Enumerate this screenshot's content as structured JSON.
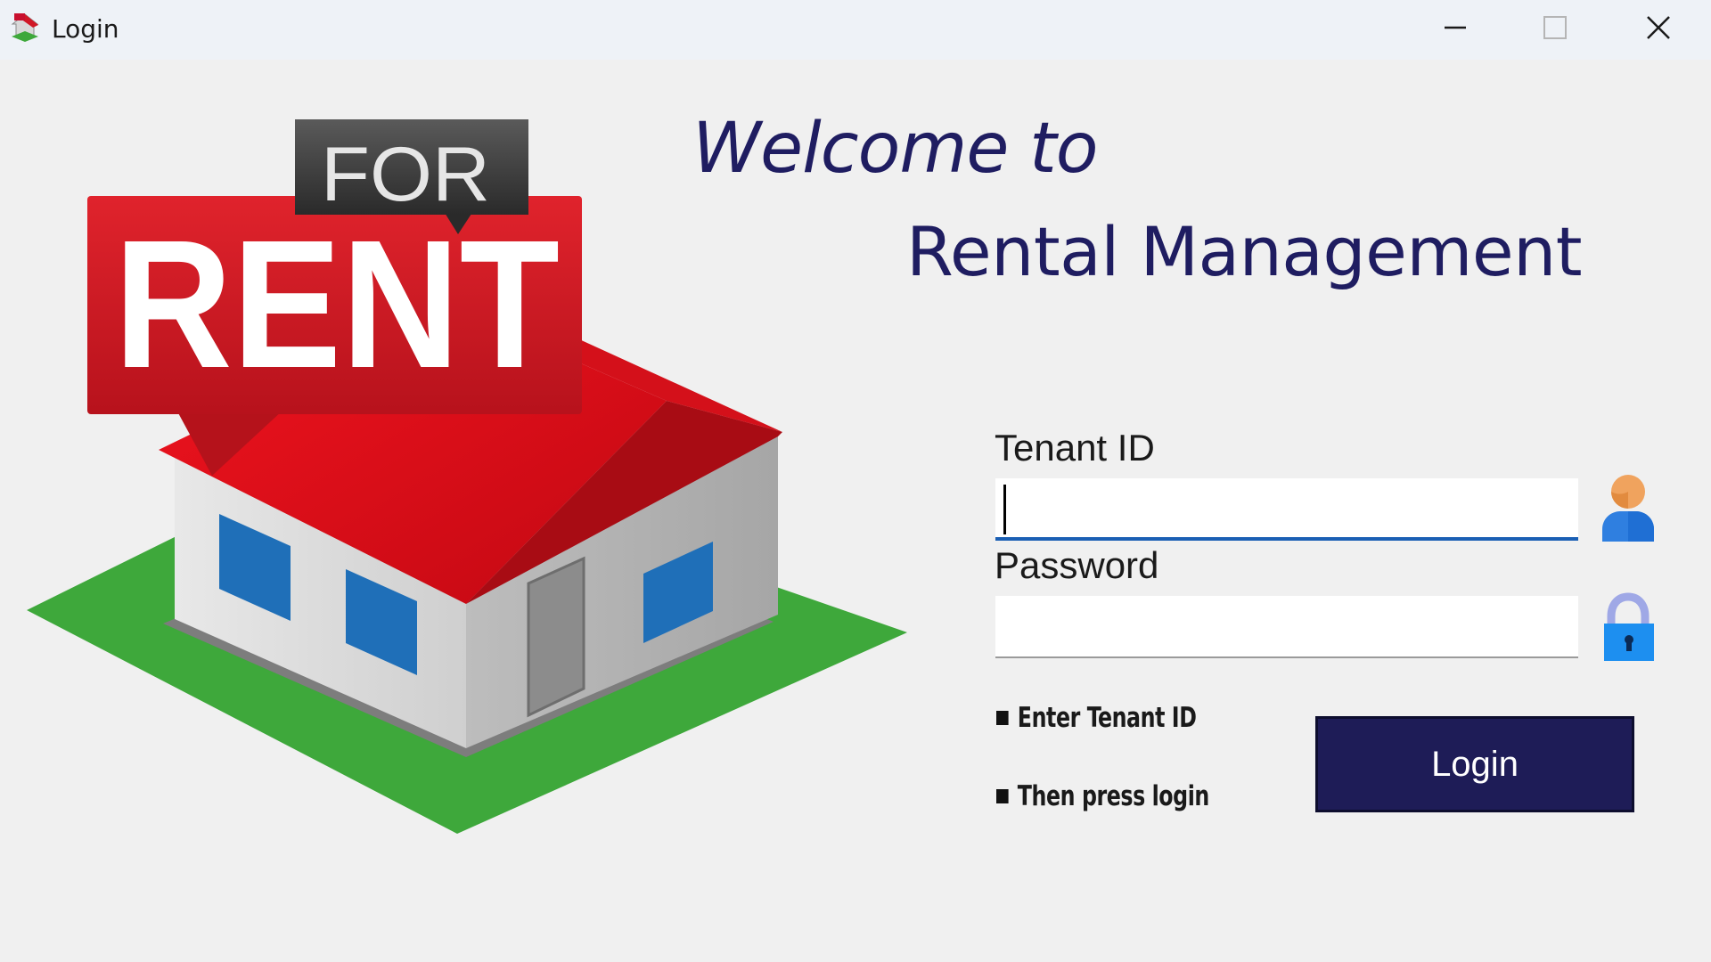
{
  "window": {
    "title": "Login",
    "controls": {
      "minimize": "minimize",
      "maximize": "maximize",
      "close": "close"
    }
  },
  "illustration": {
    "sign_top": "FOR",
    "sign_main": "RENT"
  },
  "header": {
    "welcome": "Welcome to",
    "app_name": "Rental Management"
  },
  "form": {
    "tenant_label": "Tenant ID",
    "tenant_value": "",
    "password_label": "Password",
    "password_value": ""
  },
  "hints": [
    "Enter Tenant ID",
    "Then press login"
  ],
  "actions": {
    "login_label": "Login"
  },
  "colors": {
    "brand_navy": "#1e1c57",
    "heading": "#1f1d61",
    "focus_underline": "#1a5fb4",
    "roof_red": "#e10c1a",
    "lawn_green": "#3ea83b",
    "window_blue": "#1f6fb8"
  },
  "icons": [
    "app-house-icon",
    "minimize-icon",
    "maximize-icon",
    "close-icon",
    "user-icon",
    "lock-icon"
  ]
}
